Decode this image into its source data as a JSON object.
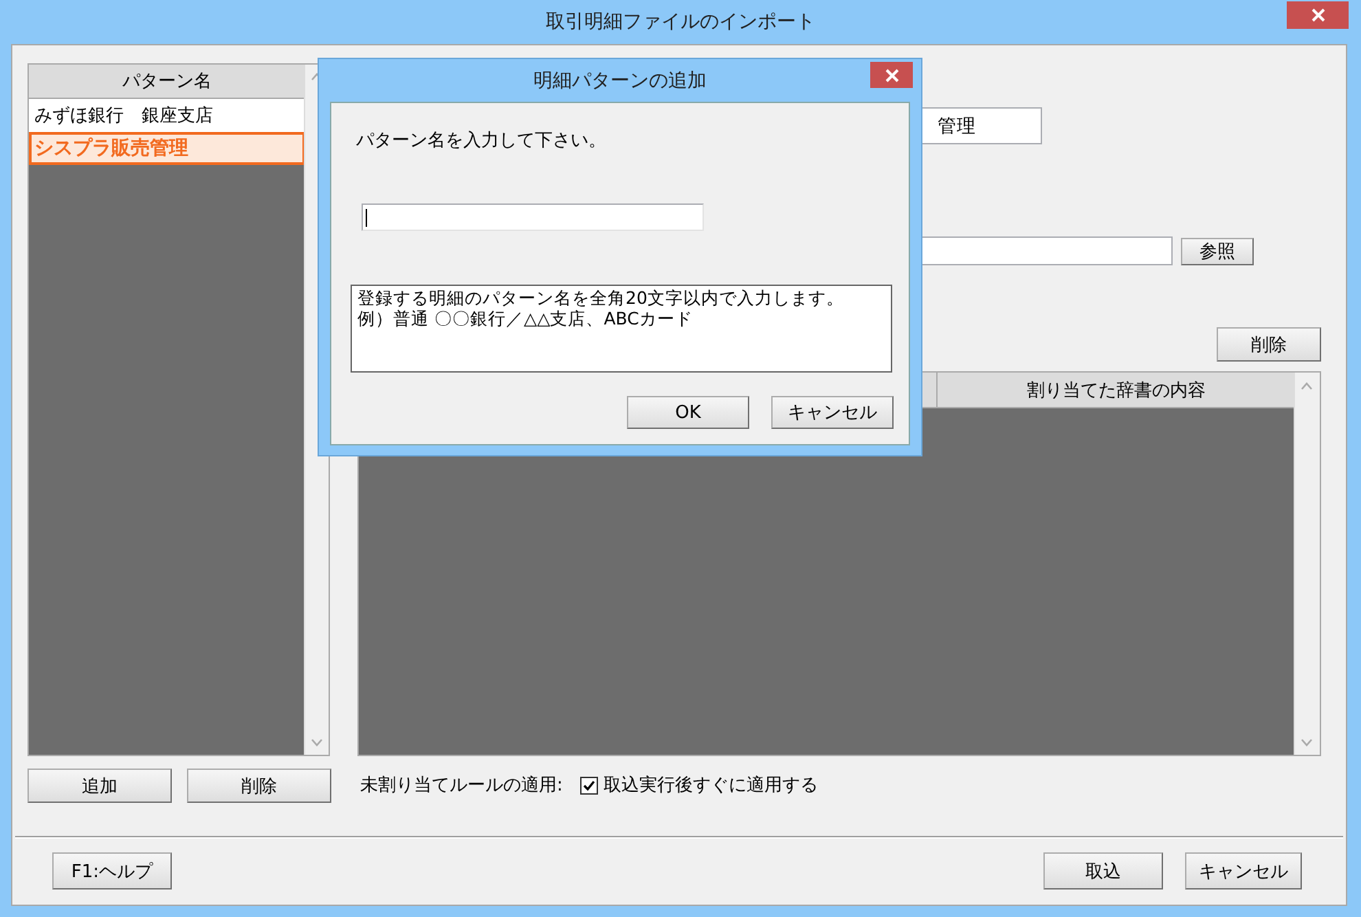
{
  "window": {
    "title": "取引明細ファイルのインポート"
  },
  "patterns": {
    "header": "パターン名",
    "items": [
      {
        "label": "みずほ銀行　銀座支店",
        "selected": false
      },
      {
        "label": "シスプラ販売管理",
        "selected": true
      }
    ]
  },
  "name_field": {
    "value": "管理"
  },
  "browse_button": "参照",
  "delete_button": "削除",
  "table": {
    "columns": [
      "割り当てた辞書の内容"
    ]
  },
  "pattern_buttons": [
    "追加",
    "削除"
  ],
  "rule": {
    "label": "未割り当てルールの適用:",
    "checkbox": {
      "label": "取込実行後すぐに適用する",
      "checked": true
    }
  },
  "footer": {
    "help": "F1:ヘルプ",
    "import": "取込",
    "cancel": "キャンセル"
  },
  "dialog": {
    "title": "明細パターンの追加",
    "prompt": "パターン名を入力して下さい。",
    "note": [
      "登録する明細のパターン名を全角20文字以内で入力します。",
      "例）普通 〇〇銀行／△△支店、ABCカード"
    ],
    "buttons": [
      "OK",
      "キャンセル"
    ]
  }
}
